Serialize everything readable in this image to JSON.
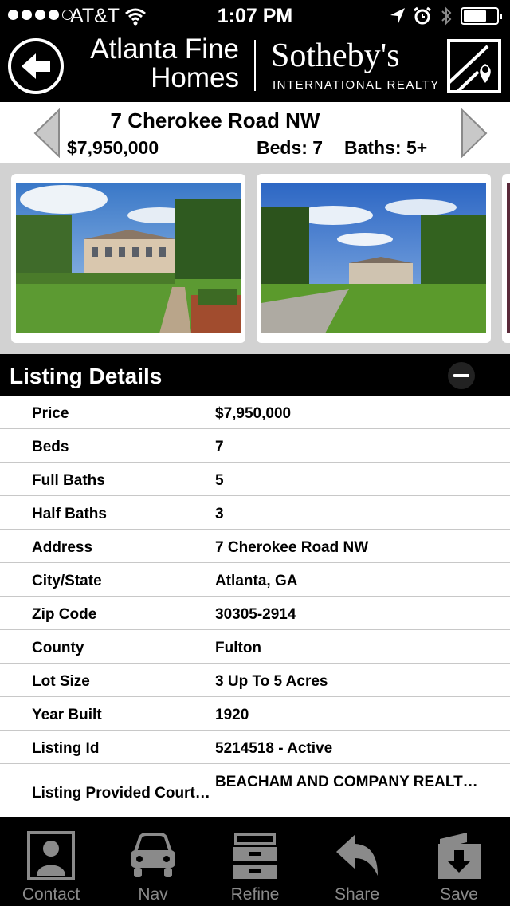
{
  "status_bar": {
    "carrier": "AT&T",
    "time": "1:07 PM"
  },
  "header": {
    "brand_line1": "Atlanta Fine",
    "brand_line2": "Homes",
    "brand_name": "Sotheby's",
    "brand_sub": "INTERNATIONAL REALTY",
    "back_icon": "back-arrow-icon",
    "map_icon": "map-pin-icon"
  },
  "listing_nav": {
    "address": "7 Cherokee Road NW",
    "price": "$7,950,000",
    "beds": "Beds: 7",
    "baths": "Baths: 5+"
  },
  "details": {
    "title": "Listing Details",
    "rows": [
      {
        "label": "Price",
        "value": "$7,950,000"
      },
      {
        "label": "Beds",
        "value": "7"
      },
      {
        "label": "Full Baths",
        "value": "5"
      },
      {
        "label": "Half Baths",
        "value": "3"
      },
      {
        "label": "Address",
        "value": "7 Cherokee Road NW"
      },
      {
        "label": "City/State",
        "value": "Atlanta, GA"
      },
      {
        "label": "Zip Code",
        "value": "30305-2914"
      },
      {
        "label": "County",
        "value": "Fulton"
      },
      {
        "label": "Lot Size",
        "value": "3 Up To 5 Acres"
      },
      {
        "label": "Year Built",
        "value": "1920"
      },
      {
        "label": "Listing Id",
        "value": "5214518 - Active"
      },
      {
        "label": "Listing Provided Court…",
        "value": "BEACHAM AND COMPANY REALT…"
      }
    ]
  },
  "tabbar": {
    "items": [
      {
        "label": "Contact",
        "icon": "contact-icon"
      },
      {
        "label": "Nav",
        "icon": "car-icon"
      },
      {
        "label": "Refine",
        "icon": "cabinet-icon"
      },
      {
        "label": "Share",
        "icon": "share-icon"
      },
      {
        "label": "Save",
        "icon": "save-folder-icon"
      }
    ]
  },
  "colors": {
    "bar_bg": "#000000",
    "tab_icon": "#8a8a8a",
    "gallery_bg": "#d2d2d2"
  }
}
